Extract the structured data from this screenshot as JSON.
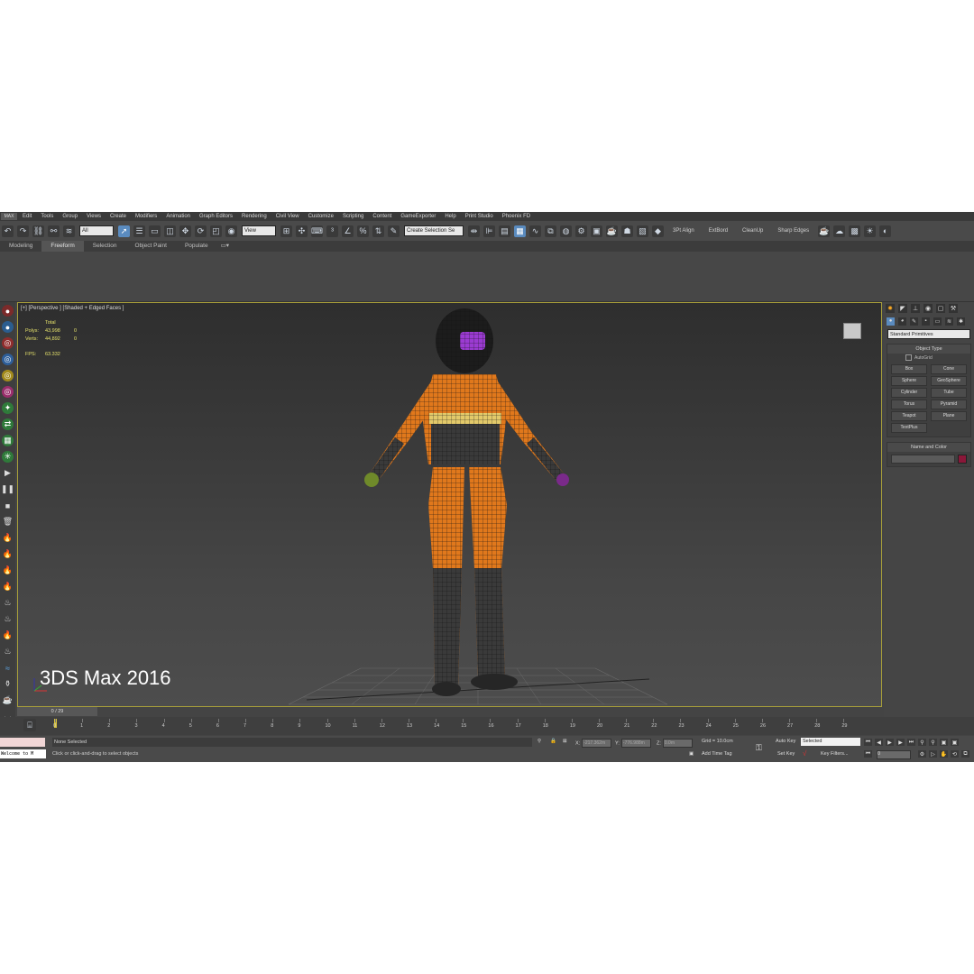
{
  "menu": {
    "logo": "MAX",
    "items": [
      "Edit",
      "Tools",
      "Group",
      "Views",
      "Create",
      "Modifiers",
      "Animation",
      "Graph Editors",
      "Rendering",
      "Civil View",
      "Customize",
      "Scripting",
      "Content",
      "GameExporter",
      "Help",
      "Print Studio",
      "Phoenix FD"
    ]
  },
  "toolbar": {
    "filter_value": "All",
    "refcoord_value": "View",
    "selection_set_value": "Create Selection Se",
    "plugin_labels": [
      "3Pt Align",
      "ExtBord",
      "CleanUp",
      "Sharp Edges"
    ]
  },
  "ribbon": {
    "tabs": [
      "Modeling",
      "Freeform",
      "Selection",
      "Object Paint",
      "Populate"
    ],
    "active_tab": "Freeform"
  },
  "viewport": {
    "label": "[+] [Perspective ] [Shaded + Edged Faces ]",
    "stats": {
      "header": "Total",
      "polys_label": "Polys:",
      "polys_total": "43,998",
      "polys_sel": "0",
      "verts_label": "Verts:",
      "verts_total": "44,892",
      "verts_sel": "0",
      "fps_label": "FPS:",
      "fps_value": "63.332"
    },
    "watermark": "3DS Max 2016"
  },
  "command_panel": {
    "dropdown": "Standard Primitives",
    "object_type_title": "Object Type",
    "autogrid_label": "AutoGrid",
    "primitives": [
      "Box",
      "Cone",
      "Sphere",
      "GeoSphere",
      "Cylinder",
      "Tube",
      "Torus",
      "Pyramid",
      "Teapot",
      "Plane",
      "TextPlus"
    ],
    "name_color_title": "Name and Color",
    "object_color": "#8a1739"
  },
  "timeline": {
    "slider_label": "0 / 29",
    "ticks": [
      "0",
      "1",
      "2",
      "3",
      "4",
      "5",
      "6",
      "7",
      "8",
      "9",
      "10",
      "11",
      "12",
      "13",
      "14",
      "15",
      "16",
      "17",
      "18",
      "19",
      "20",
      "21",
      "22",
      "23",
      "24",
      "25",
      "26",
      "27",
      "28",
      "29"
    ]
  },
  "statusbar": {
    "listener_text": "Welcome to M",
    "selection_status": "None Selected",
    "prompt": "Click or click-and-drag to select objects",
    "x_label": "X:",
    "x_value": "-217.362m",
    "y_label": "Y:",
    "y_value": "-776.988m",
    "z_label": "Z:",
    "z_value": "0.0m",
    "grid": "Grid = 10.0cm",
    "add_time_tag": "Add Time Tag",
    "auto_key": "Auto Key",
    "set_key": "Set Key",
    "key_mode_value": "Selected",
    "key_filters": "Key Filters...",
    "frame_value": "0"
  }
}
